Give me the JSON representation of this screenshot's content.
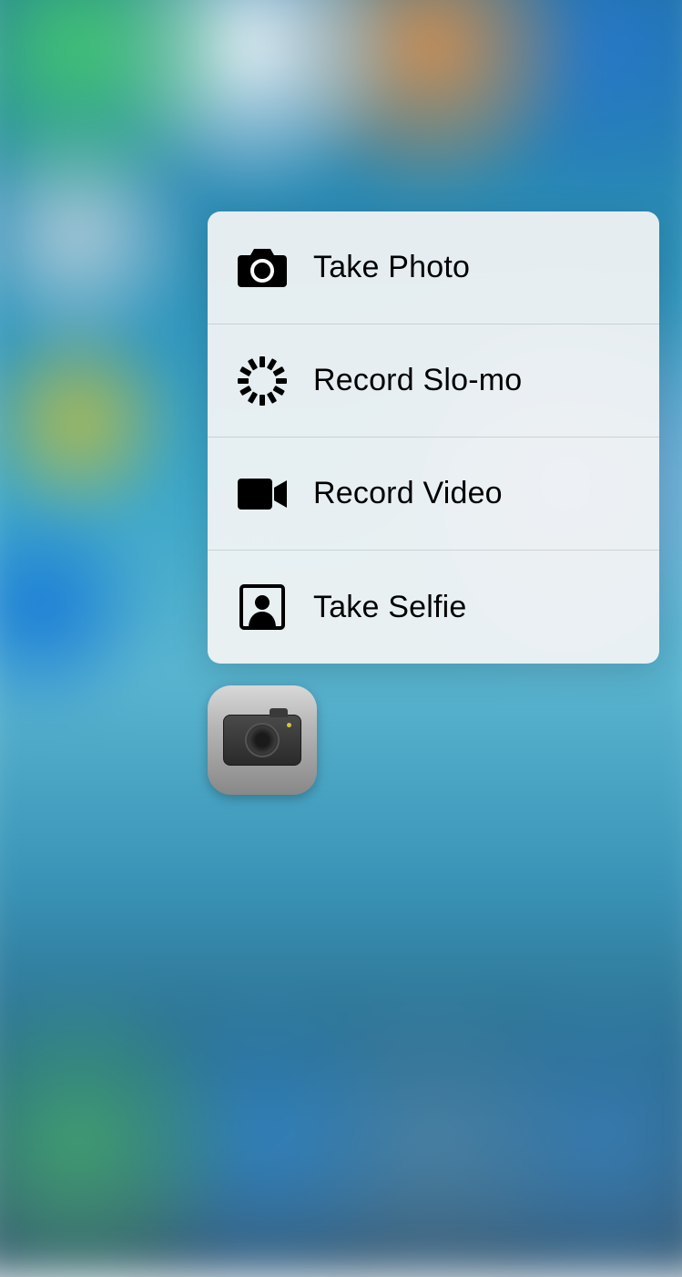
{
  "quick_actions": {
    "items": [
      {
        "icon": "camera-icon",
        "label": "Take Photo"
      },
      {
        "icon": "slomo-icon",
        "label": "Record Slo-mo"
      },
      {
        "icon": "video-icon",
        "label": "Record Video"
      },
      {
        "icon": "selfie-icon",
        "label": "Take Selfie"
      }
    ]
  },
  "app": {
    "name": "Camera"
  }
}
